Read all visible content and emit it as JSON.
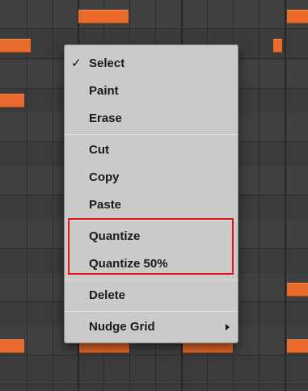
{
  "context_menu": {
    "items": [
      {
        "label": "Select",
        "checked": true,
        "check_glyph": "✓"
      },
      {
        "label": "Paint"
      },
      {
        "label": "Erase"
      },
      {
        "label": "Cut"
      },
      {
        "label": "Copy"
      },
      {
        "label": "Paste"
      },
      {
        "label": "Quantize"
      },
      {
        "label": "Quantize 50%"
      },
      {
        "label": "Delete"
      },
      {
        "label": "Nudge Grid",
        "submenu": true
      }
    ]
  },
  "colors": {
    "note": "#ea6a2c",
    "menu_background": "#cacaca",
    "highlight": "#e0141b",
    "grid_background": "#3b3b3b"
  },
  "icons": {
    "check": "check-icon",
    "submenu": "submenu-arrow-icon"
  }
}
